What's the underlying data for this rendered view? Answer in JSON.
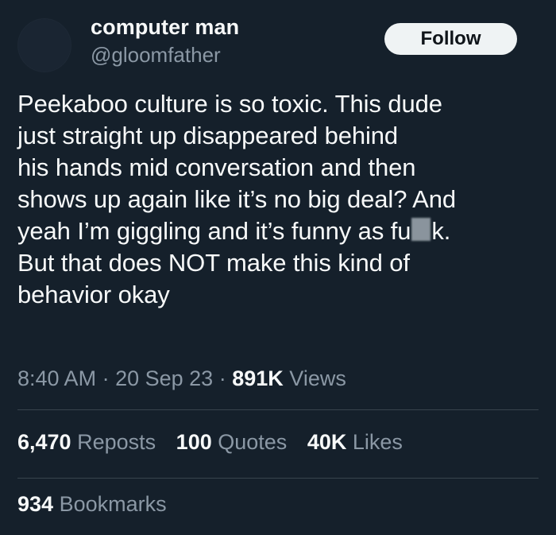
{
  "colors": {
    "background": "#15202b",
    "primary_text": "#f7f9f9",
    "secondary_text": "#8b98a5",
    "divider": "#38444d",
    "follow_button_bg": "#eff3f4",
    "follow_button_text": "#0f1419"
  },
  "author": {
    "display_name": "computer man",
    "handle": "@gloomfather"
  },
  "actions": {
    "follow_label": "Follow"
  },
  "tweet": {
    "text_before_censor": "Peekaboo culture is so toxic. This dude\njust straight up disappeared behind\nhis hands mid conversation and then\nshows up again like it’s no big deal? And\nyeah I’m giggling and it’s funny as fu",
    "text_after_censor": "k.\nBut that does NOT make this kind of\nbehavior okay",
    "time": "8:40 AM",
    "separator_1": "·",
    "date": "20 Sep 23",
    "separator_2": "·",
    "views_count": "891K",
    "views_label": "Views"
  },
  "stats": {
    "reposts_count": "6,470",
    "reposts_label": "Reposts",
    "quotes_count": "100",
    "quotes_label": "Quotes",
    "likes_count": "40K",
    "likes_label": "Likes",
    "bookmarks_count": "934",
    "bookmarks_label": "Bookmarks"
  }
}
